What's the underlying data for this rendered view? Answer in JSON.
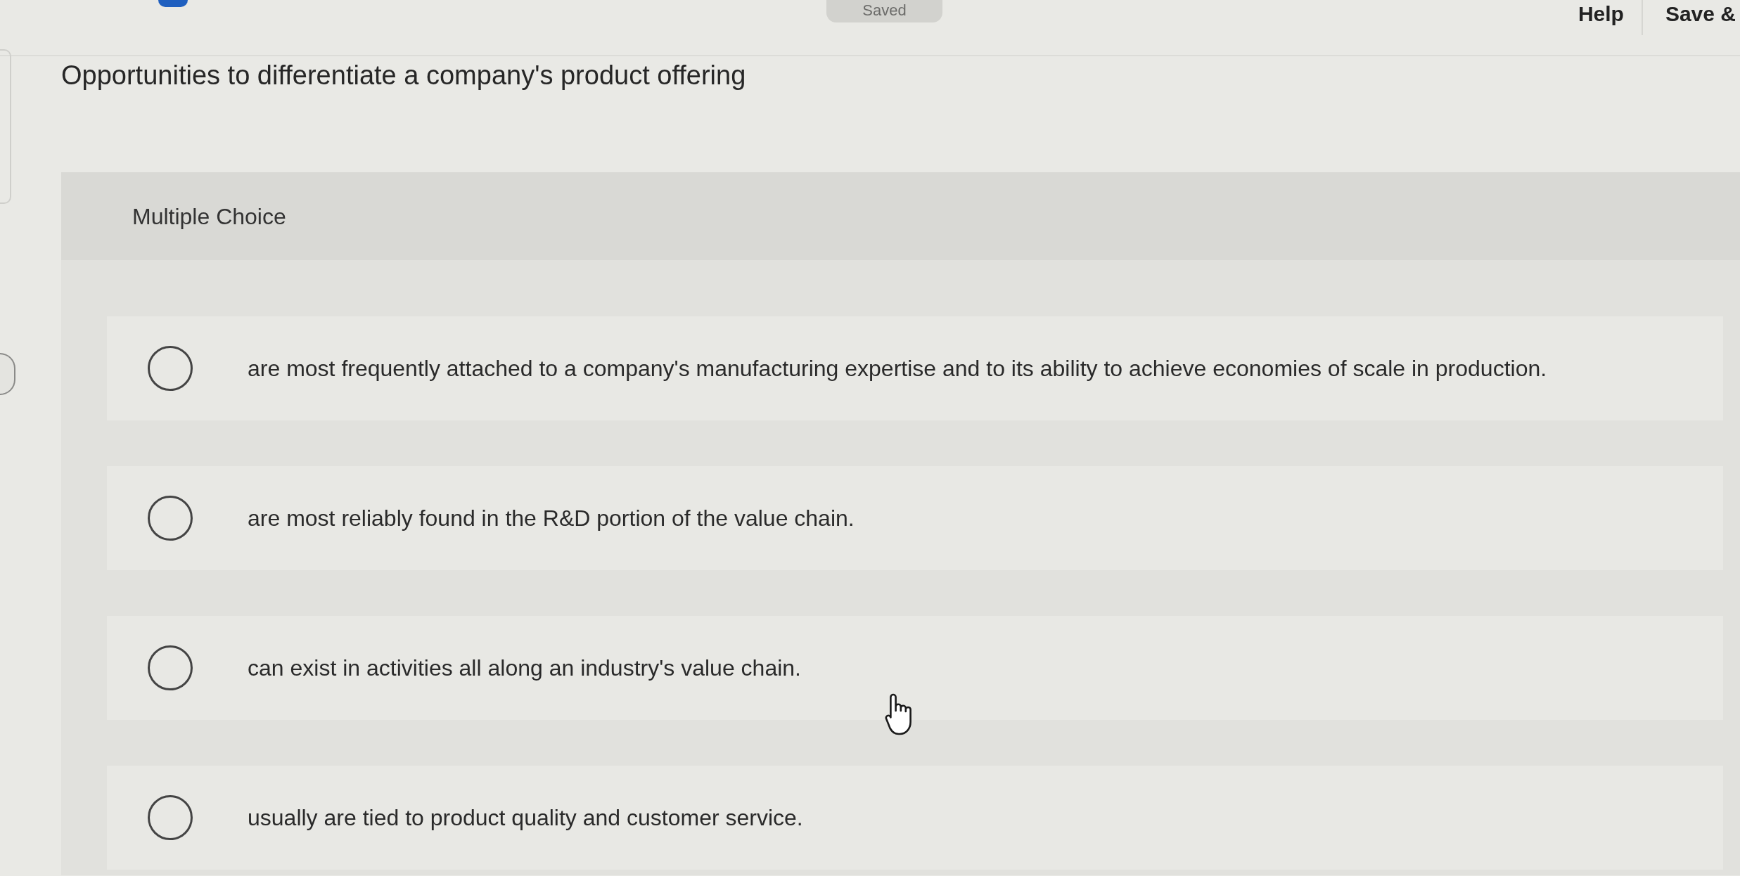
{
  "top_bar": {
    "status_badge": "Saved",
    "links": [
      {
        "kind": "help",
        "label": "Help"
      },
      {
        "kind": "save",
        "label": "Save &"
      }
    ]
  },
  "question": {
    "prompt": "Opportunities to differentiate a company's product offering",
    "type_label": "Multiple Choice",
    "choices": [
      {
        "text": "are most frequently attached to a company's manufacturing expertise and to its ability to achieve economies of scale in production.",
        "selected": false
      },
      {
        "text": "are most reliably found in the R&D portion of the value chain.",
        "selected": false
      },
      {
        "text": "can exist in activities all along an industry's value chain.",
        "selected": false
      },
      {
        "text": "usually are tied to product quality and customer service.",
        "selected": false
      }
    ]
  }
}
